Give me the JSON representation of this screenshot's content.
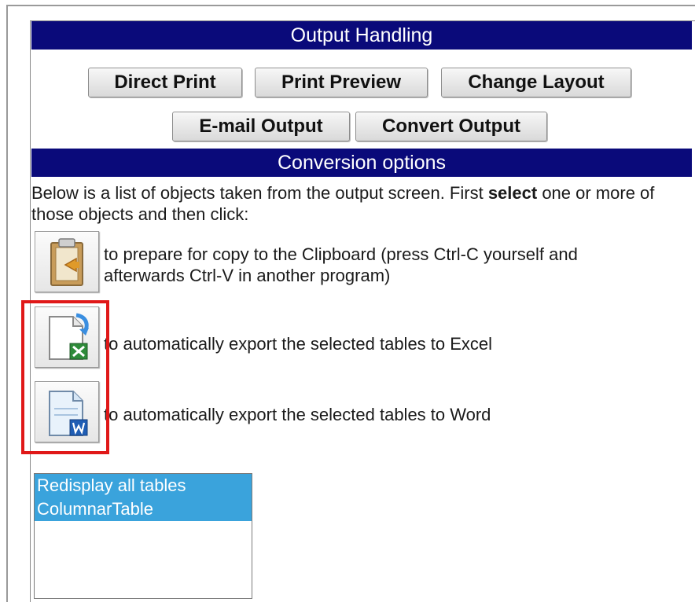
{
  "output_handling": {
    "title": "Output Handling",
    "buttons": {
      "direct_print": "Direct Print",
      "print_preview": "Print Preview",
      "change_layout": "Change Layout",
      "email_output": "E-mail Output",
      "convert_output": "Convert Output"
    }
  },
  "conversion_options": {
    "title": "Conversion options",
    "description_before": "Below is a list of objects taken from the output screen. First ",
    "description_bold": "select",
    "description_after": " one or more of those objects and then click:",
    "clipboard_line1": "to prepare for copy to the Clipboard (press Ctrl-C yourself and",
    "clipboard_line2": "afterwards Ctrl-V in another program)",
    "excel_text": "to automatically export the selected tables to Excel",
    "word_text": "to automatically export the selected tables to Word"
  },
  "table_list": {
    "items": [
      "Redisplay all tables",
      "ColumnarTable"
    ]
  },
  "icons": {
    "clipboard": "clipboard-icon",
    "excel": "excel-export-icon",
    "word": "word-export-icon"
  },
  "colors": {
    "section_bar": "#0a0a7a",
    "list_selected": "#3aa3dc",
    "highlight_border": "#e01818"
  }
}
